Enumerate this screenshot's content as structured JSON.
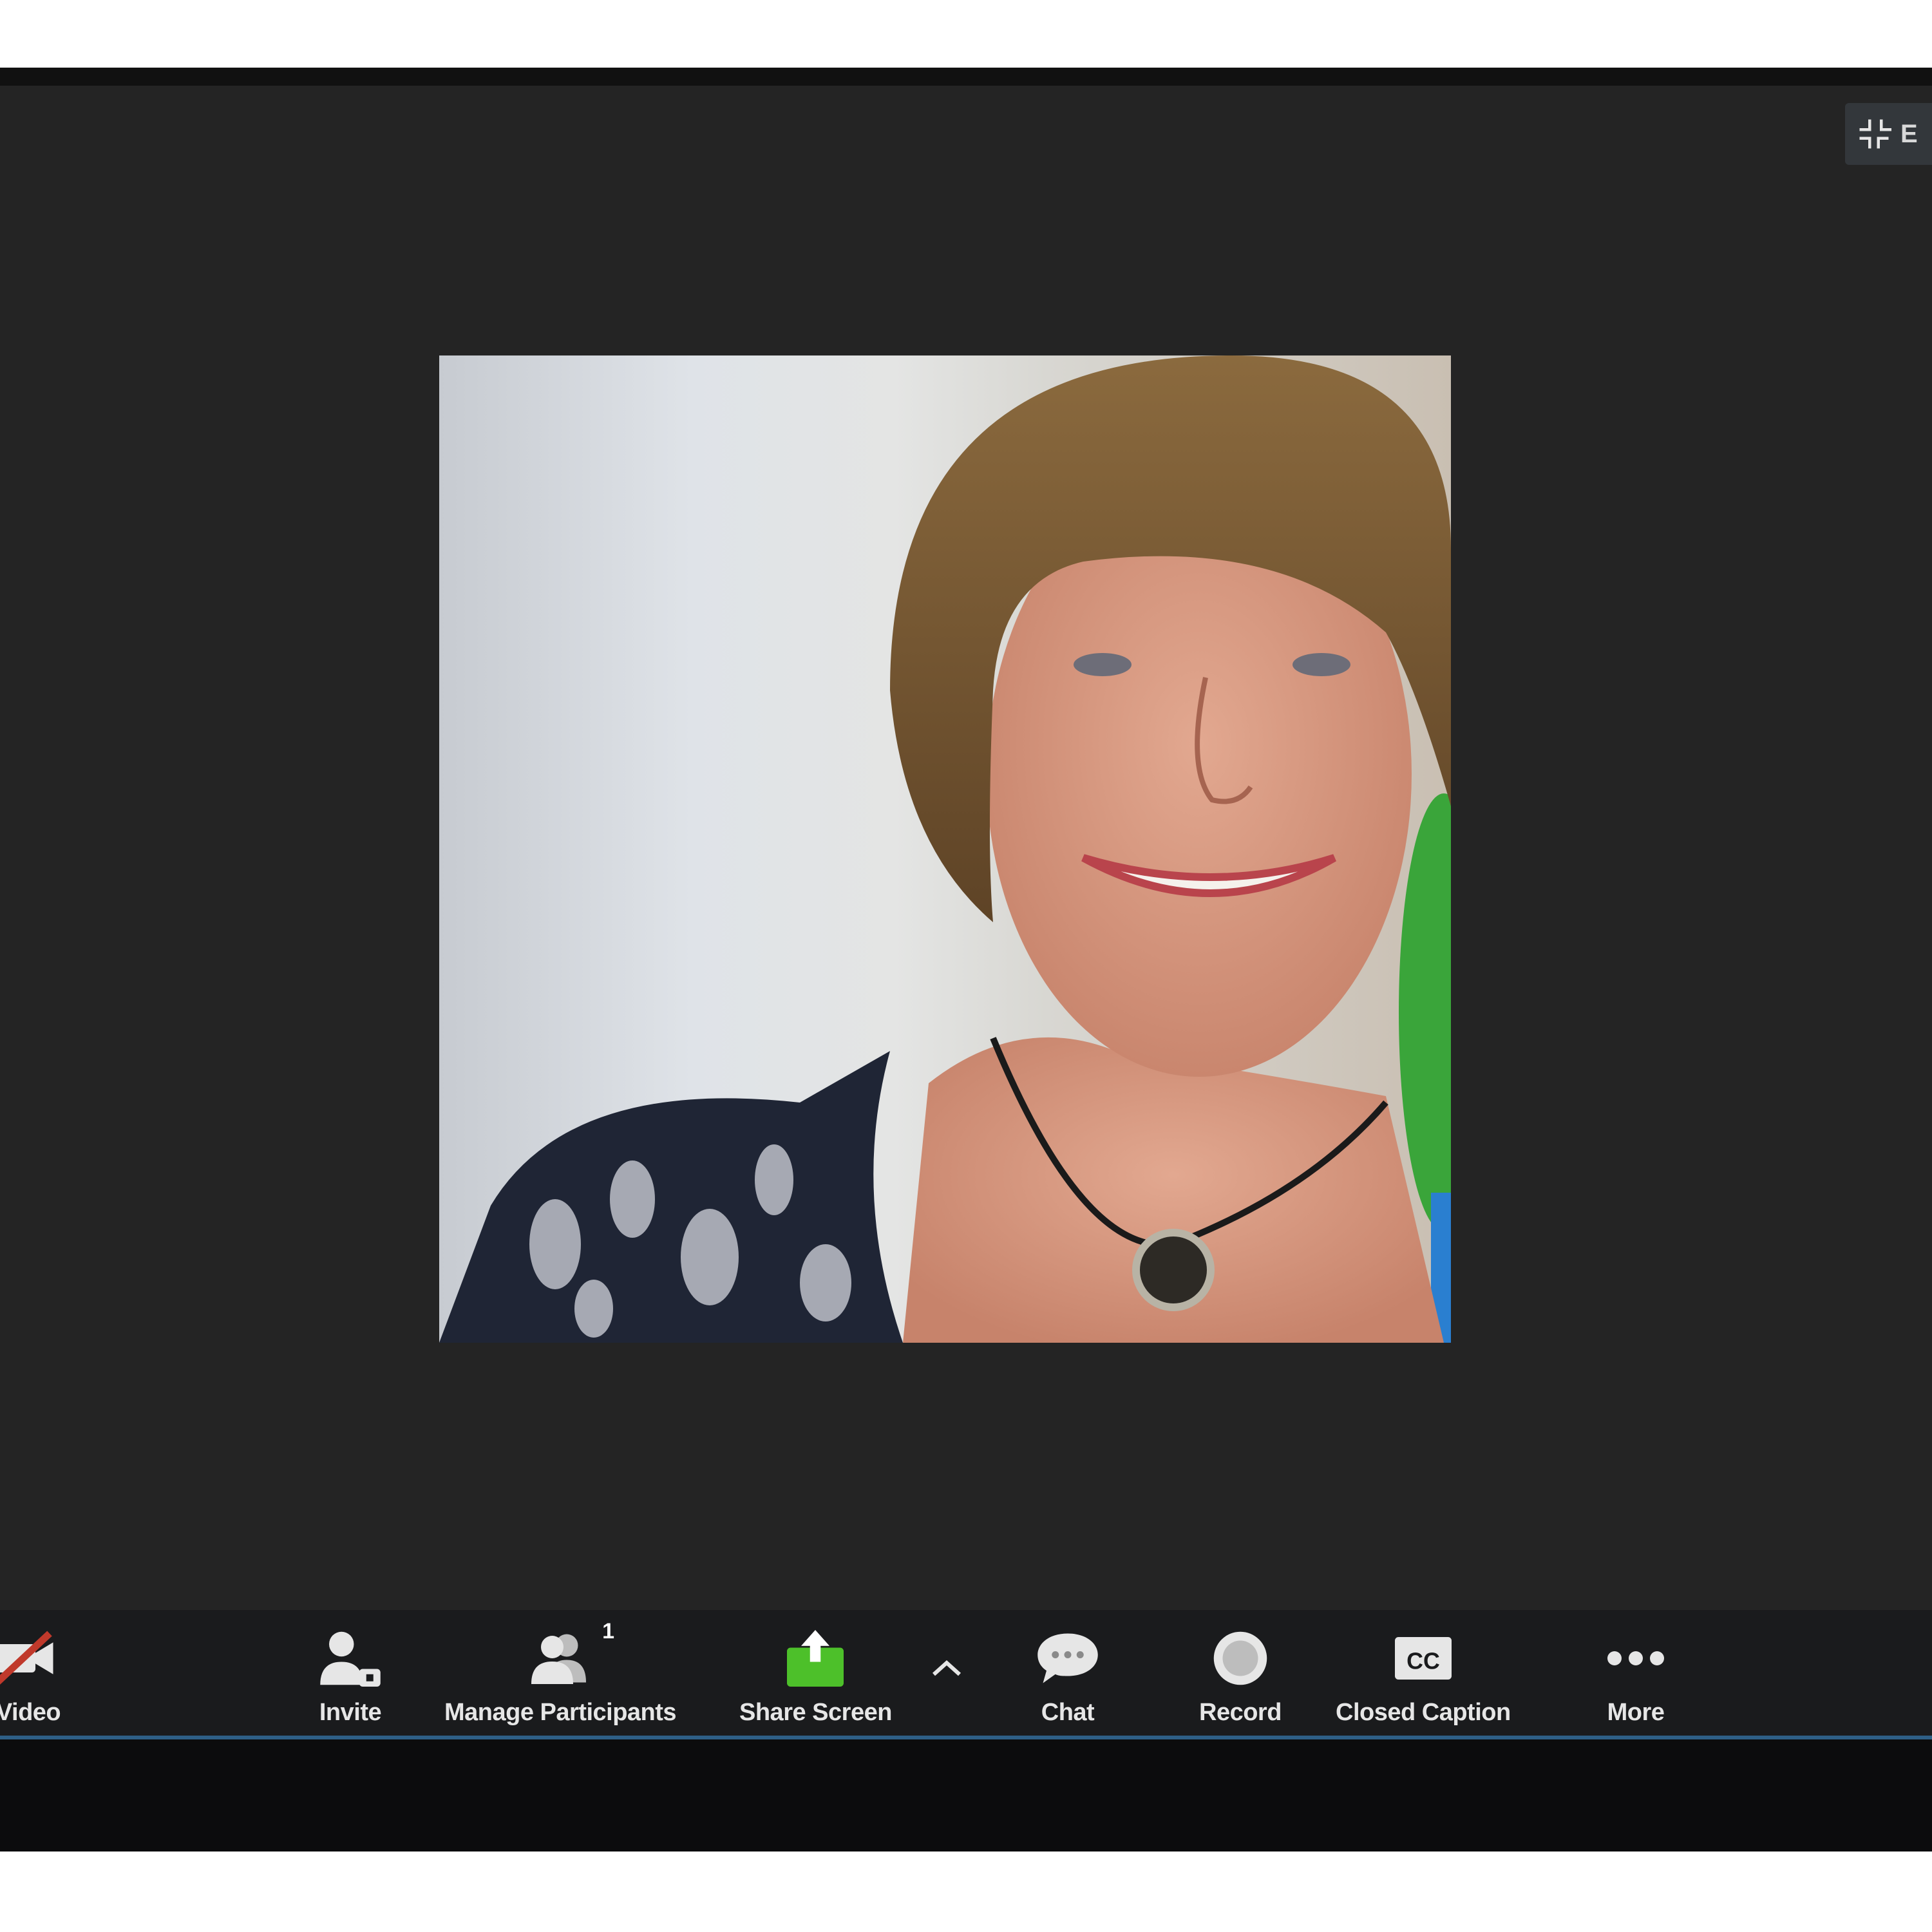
{
  "window": {
    "exit_fullscreen_label": "E",
    "exit_fullscreen_icon": "exit-fullscreen-icon"
  },
  "video": {
    "participant_icon": "participant-video"
  },
  "toolbar": {
    "buttons": [
      {
        "id": "video",
        "label": "Video",
        "icon": "video-off-icon"
      },
      {
        "id": "invite",
        "label": "Invite",
        "icon": "invite-icon"
      },
      {
        "id": "participants",
        "label": "Manage Participants",
        "icon": "participants-icon",
        "count": "1"
      },
      {
        "id": "share",
        "label": "Share Screen",
        "icon": "share-screen-icon"
      },
      {
        "id": "chat",
        "label": "Chat",
        "icon": "chat-icon"
      },
      {
        "id": "record",
        "label": "Record",
        "icon": "record-icon"
      },
      {
        "id": "cc",
        "label": "Closed Caption",
        "icon": "closed-caption-icon",
        "icon_text": "CC"
      },
      {
        "id": "more",
        "label": "More",
        "icon": "more-icon"
      }
    ]
  },
  "colors": {
    "meeting_bg": "#242424",
    "toolbar_bg": "#1a1b1d",
    "share_green": "#4dc02a",
    "divider_blue": "#2e5f86"
  }
}
